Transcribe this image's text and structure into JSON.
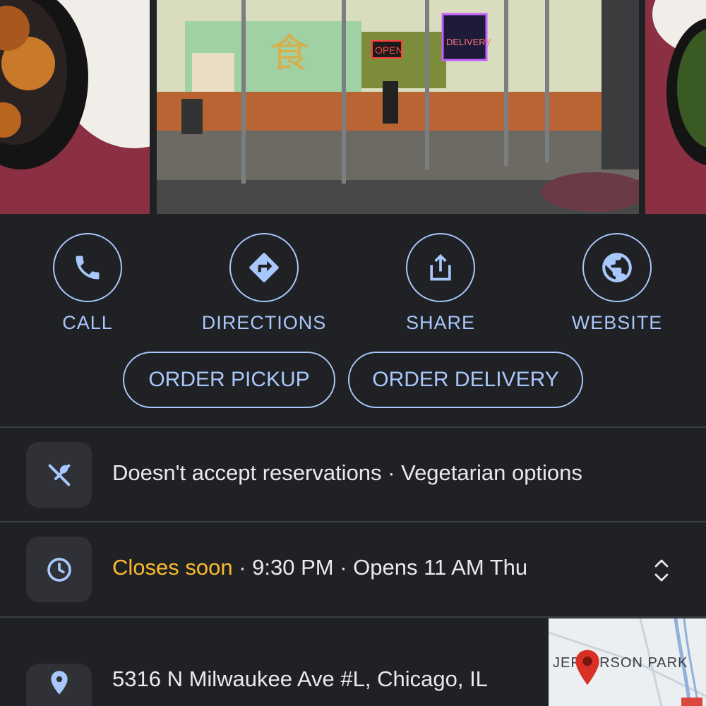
{
  "actions": [
    {
      "label": "CALL",
      "icon": "phone-icon"
    },
    {
      "label": "DIRECTIONS",
      "icon": "directions-icon"
    },
    {
      "label": "SHARE",
      "icon": "share-icon"
    },
    {
      "label": "WEBSITE",
      "icon": "globe-icon"
    }
  ],
  "order": {
    "pickup": "ORDER PICKUP",
    "delivery": "ORDER DELIVERY"
  },
  "amenities": {
    "text": "Doesn't accept reservations · Vegetarian options",
    "icon": "restaurant-icon"
  },
  "hours": {
    "status": "Closes soon",
    "rest": " · 9:30 PM · Opens 11 AM Thu",
    "icon": "clock-icon"
  },
  "address": {
    "line1": "5316 N Milwaukee Ave #L, Chicago, IL",
    "icon": "location-pin-icon"
  },
  "map": {
    "label": "JEFFERSON PARK"
  },
  "photo_signs": {
    "open": "OPEN",
    "delivery": "DELIVERY"
  },
  "colors": {
    "accent": "#a8c7fa",
    "warning": "#f9bb2d",
    "background": "#202124",
    "map_pin": "#d93025"
  }
}
